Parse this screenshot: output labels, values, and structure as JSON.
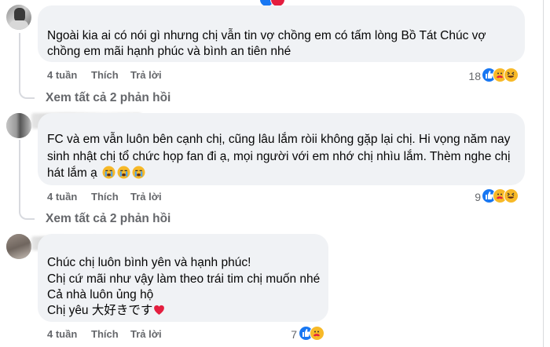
{
  "comments": [
    {
      "text_lines": [
        "Ngoài kia ai có nói gì nhưng chị vẫn tin vợ chồng em có tấm lòng Bồ Tát Chúc vợ",
        "chồng em mãi hạnh phúc và bình an tiên nhé"
      ],
      "time": "4 tuần",
      "like": "Thích",
      "reply": "Trả lời",
      "reaction_count": "18",
      "reactions": [
        "like-icon",
        "care-icon",
        "haha-icon"
      ],
      "view_replies": "Xem tất cả 2 phản hồi"
    },
    {
      "text_lines": [
        "FC và em vẫn luôn bên cạnh chị, cũng lâu lắm ròii không gặp lại chị. Hi vọng năm nay",
        "sinh nhật chị tổ chức họp fan đi ạ, mọi người với em nhớ chị nhìu lắm. Thèm nghe chị",
        "hát lắm ạ"
      ],
      "text_emojis": [
        "crying-face-emoji",
        "crying-face-emoji",
        "crying-face-emoji"
      ],
      "time": "4 tuần",
      "like": "Thích",
      "reply": "Trả lời",
      "reaction_count": "9",
      "reactions": [
        "like-icon",
        "care-icon",
        "haha-icon"
      ],
      "view_replies": "Xem tất cả 2 phản hồi"
    },
    {
      "text_lines": [
        "Chúc chị luôn bình yên và hạnh phúc!",
        "Chị cứ mãi như vậy làm theo trái tim chị muốn nhé",
        "Cả nhà luôn ủng hộ",
        "Chị yêu 大好きです"
      ],
      "text_emojis": [
        "red-heart-emoji"
      ],
      "time": "4 tuần",
      "like": "Thích",
      "reply": "Trả lời",
      "reaction_count": "7",
      "reactions": [
        "like-icon",
        "care-icon"
      ]
    }
  ],
  "colors": {
    "bubble": "#f0f2f5",
    "meta": "#65676b",
    "like": "#1877f2",
    "care": "#f7b928",
    "heart": "#e41e3f"
  }
}
